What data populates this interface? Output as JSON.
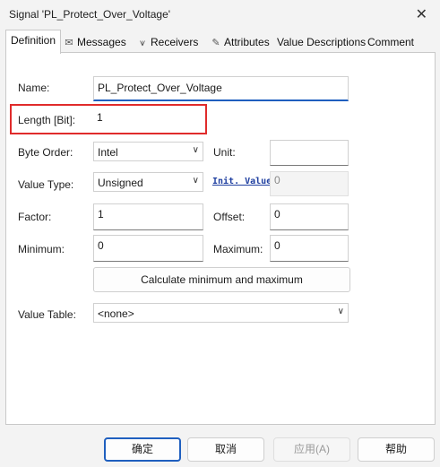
{
  "window": {
    "title": "Signal 'PL_Protect_Over_Voltage'",
    "close_icon": "close-icon"
  },
  "tabs": [
    {
      "label": "Definition",
      "icon": ""
    },
    {
      "label": "Messages",
      "icon": "envelope-icon"
    },
    {
      "label": "Receivers",
      "icon": "receiver-icon"
    },
    {
      "label": "Attributes",
      "icon": "pencil-icon"
    },
    {
      "label": "Value Descriptions",
      "icon": ""
    },
    {
      "label": "Comment",
      "icon": ""
    }
  ],
  "form": {
    "name_label": "Name:",
    "name_value": "PL_Protect_Over_Voltage",
    "length_label": "Length [Bit]:",
    "length_value": "1",
    "byte_order_label": "Byte Order:",
    "byte_order_value": "Intel",
    "unit_label": "Unit:",
    "unit_value": "",
    "value_type_label": "Value Type:",
    "value_type_value": "Unsigned",
    "init_value_label": "Init. Value",
    "init_value_value": "0",
    "factor_label": "Factor:",
    "factor_value": "1",
    "offset_label": "Offset:",
    "offset_value": "0",
    "minimum_label": "Minimum:",
    "minimum_value": "0",
    "maximum_label": "Maximum:",
    "maximum_value": "0",
    "calc_button_label": "Calculate minimum and maximum",
    "value_table_label": "Value Table:",
    "value_table_value": "<none>"
  },
  "highlight_color": "#e02b2b",
  "footer": {
    "ok_label": "确定",
    "cancel_label": "取消",
    "apply_label": "应用(A)",
    "help_label": "帮助"
  }
}
